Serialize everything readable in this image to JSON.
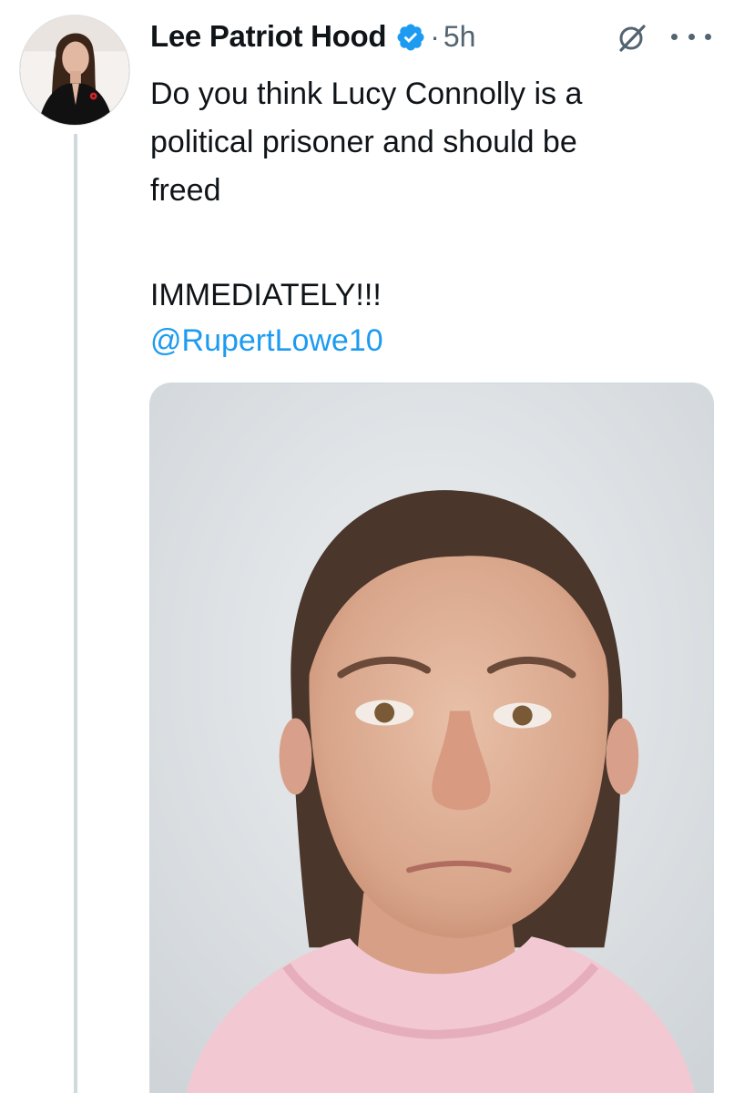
{
  "post": {
    "author_name": "Lee Patriot Hood",
    "separator": "·",
    "timestamp": "5h",
    "text": "Do you think Lucy Connolly is a\npolitical prisoner and should be\nfreed",
    "emphasis": "IMMEDIATELY!!!",
    "mention": "@RupertLowe10"
  },
  "icons": {
    "verified": "verified-badge-icon",
    "grok": "grok-icon",
    "more": "more-options-icon"
  },
  "colors": {
    "text": "#0f1419",
    "secondary": "#536471",
    "link": "#1d9bf0",
    "verified": "#1d9bf0",
    "thread_line": "#cfd9de"
  }
}
